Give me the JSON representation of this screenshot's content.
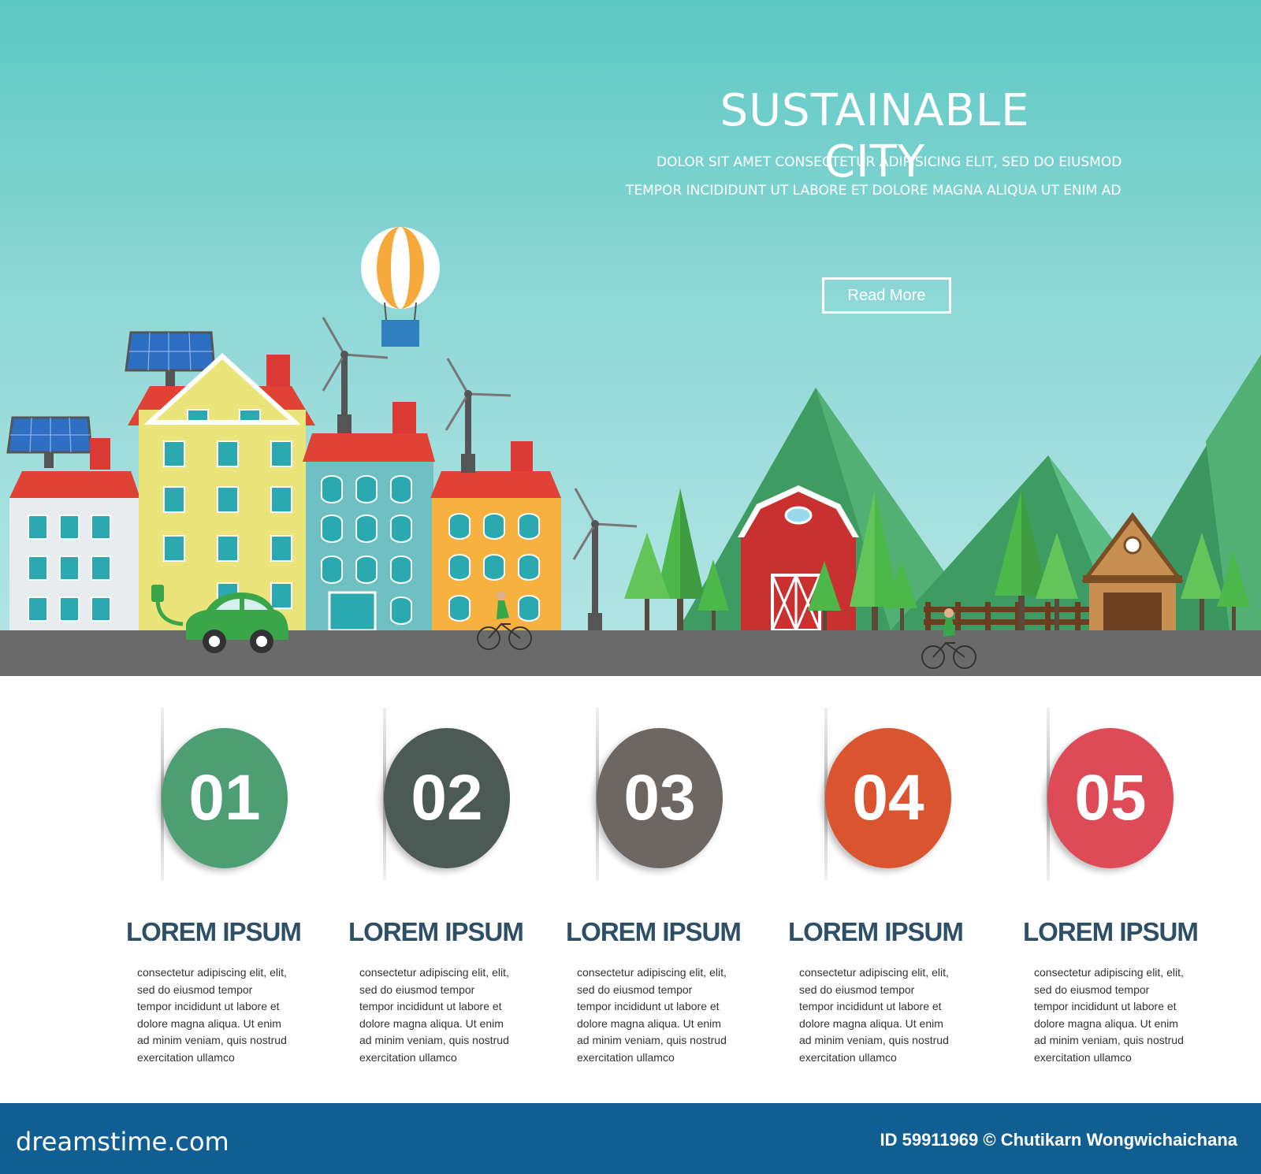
{
  "hero": {
    "title": "SUSTAINABLE CITY",
    "subtitle_line1": "DOLOR SIT AMET CONSECTETUR ADIPISICING ELIT, SED DO EIUSMOD",
    "subtitle_line2": "TEMPOR INCIDIDUNT UT LABORE ET DOLORE MAGNA ALIQUA UT ENIM AD",
    "button_label": "Read More"
  },
  "steps": [
    {
      "number": "01",
      "color": "#4e9e74",
      "title": "LOREM IPSUM",
      "body": "consectetur adipiscing elit, elit, sed do eiusmod tempor tempor incididunt ut labore et dolore magna aliqua. Ut enim ad minim veniam, quis nostrud exercitation ullamco"
    },
    {
      "number": "02",
      "color": "#4b5a55",
      "title": "LOREM IPSUM",
      "body": "consectetur adipiscing elit, elit, sed do eiusmod tempor tempor incididunt ut labore et dolore magna aliqua. Ut enim ad minim veniam, quis nostrud exercitation ullamco"
    },
    {
      "number": "03",
      "color": "#6d6763",
      "title": "LOREM IPSUM",
      "body": "consectetur adipiscing elit, elit, sed do eiusmod tempor tempor incididunt ut labore et dolore magna aliqua. Ut enim ad minim veniam, quis nostrud exercitation ullamco"
    },
    {
      "number": "04",
      "color": "#d9542f",
      "title": "LOREM IPSUM",
      "body": "consectetur adipiscing elit, elit, sed do eiusmod tempor tempor incididunt ut labore et dolore magna aliqua. Ut enim ad minim veniam, quis nostrud exercitation ullamco"
    },
    {
      "number": "05",
      "color": "#dd4b57",
      "title": "LOREM IPSUM",
      "body": "consectetur adipiscing elit, elit, sed do eiusmod tempor tempor incididunt ut labore et dolore magna aliqua. Ut enim ad minim veniam, quis nostrud exercitation ullamco"
    }
  ],
  "footer": {
    "brand": "dreamstime.com",
    "credit": "ID 59911969 © Chutikarn Wongwichaichana",
    "background": "#115e92"
  }
}
